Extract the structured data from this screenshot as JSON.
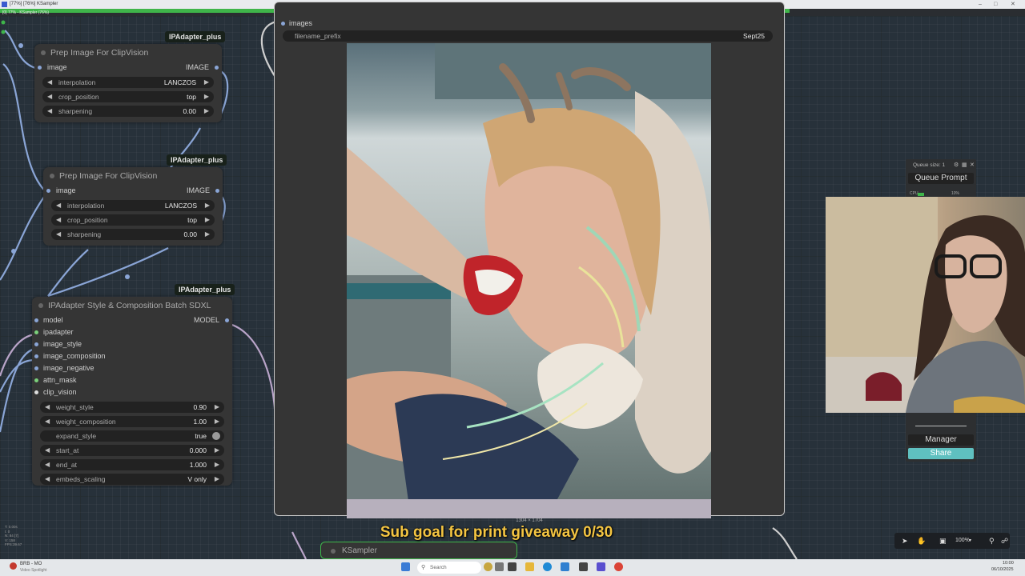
{
  "window": {
    "title": "[77%] [76%] KSampler",
    "progress_label": "[0] 77% - KSampler (76%)",
    "progress_fraction": 0.77
  },
  "nodes": {
    "prep1": {
      "badge": "IPAdapter_plus",
      "title": "Prep Image For ClipVision",
      "input": "image",
      "output": "IMAGE",
      "widgets": [
        {
          "label": "interpolation",
          "value": "LANCZOS"
        },
        {
          "label": "crop_position",
          "value": "top"
        },
        {
          "label": "sharpening",
          "value": "0.00"
        }
      ]
    },
    "prep2": {
      "badge": "IPAdapter_plus",
      "title": "Prep Image For ClipVision",
      "input": "image",
      "output": "IMAGE",
      "widgets": [
        {
          "label": "interpolation",
          "value": "LANCZOS"
        },
        {
          "label": "crop_position",
          "value": "top"
        },
        {
          "label": "sharpening",
          "value": "0.00"
        }
      ]
    },
    "style": {
      "badge": "IPAdapter_plus",
      "title": "IPAdapter Style & Composition Batch SDXL",
      "output": "MODEL",
      "inputs": [
        "model",
        "ipadapter",
        "image_style",
        "image_composition",
        "image_negative",
        "attn_mask",
        "clip_vision"
      ],
      "widgets": [
        {
          "label": "weight_style",
          "value": "0.90",
          "kind": "number"
        },
        {
          "label": "weight_composition",
          "value": "1.00",
          "kind": "number"
        },
        {
          "label": "expand_style",
          "value": "true",
          "kind": "toggle"
        },
        {
          "label": "start_at",
          "value": "0.000",
          "kind": "number"
        },
        {
          "label": "end_at",
          "value": "1.000",
          "kind": "number"
        },
        {
          "label": "embeds_scaling",
          "value": "V only",
          "kind": "combo"
        }
      ]
    },
    "save": {
      "input": "images",
      "widget_label": "filename_prefix",
      "widget_value": "Sept25",
      "image_size": "1304 × 1704"
    },
    "ksampler": {
      "title": "KSampler"
    }
  },
  "queue": {
    "size_label": "Queue size: 1",
    "queue_button": "Queue Prompt",
    "manager_button": "Manager",
    "share_button": "Share",
    "cpu_label": "CPU",
    "cpu_value": "10%"
  },
  "overlay": {
    "subtitle": "Sub goal for print giveaway 0/30"
  },
  "zoom": {
    "level": "100%"
  },
  "stats": [
    "T: 0.00s",
    "I: 0",
    "N: 84 [7]",
    "V: 158",
    "FPS:39.67"
  ],
  "taskbar": {
    "notif_title": "BRB - MO",
    "notif_sub": "Video Spotlight",
    "search_placeholder": "Search",
    "time": "10:00",
    "date": "06/10/2025"
  },
  "colors": {
    "progress": "#3fb54a",
    "share": "#5fc0c0",
    "subtitle": "#f4c542",
    "link_blue": "#8aa5d6",
    "link_purple": "#b9a4c8"
  }
}
